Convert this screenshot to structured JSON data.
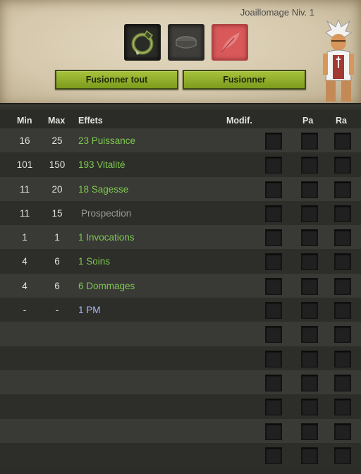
{
  "job": {
    "level_label": "Joaillomage Niv. 1"
  },
  "slots": [
    {
      "icon": "ring-item-icon",
      "state": "filled"
    },
    {
      "icon": "rune-slot-icon",
      "state": "empty"
    },
    {
      "icon": "feather-icon",
      "state": "empty"
    }
  ],
  "buttons": {
    "merge_all": "Fusionner tout",
    "merge": "Fusionner"
  },
  "columns": {
    "min": "Min",
    "max": "Max",
    "effects": "Effets",
    "modif": "Modif.",
    "pa": "Pa",
    "ra": "Ra"
  },
  "rows": [
    {
      "min": "16",
      "max": "25",
      "effect": "23 Puissance",
      "color": "green"
    },
    {
      "min": "101",
      "max": "150",
      "effect": "193 Vitalité",
      "color": "green"
    },
    {
      "min": "11",
      "max": "20",
      "effect": "18 Sagesse",
      "color": "green"
    },
    {
      "min": "11",
      "max": "15",
      "effect": "Prospection",
      "color": "grey"
    },
    {
      "min": "1",
      "max": "1",
      "effect": "1 Invocations",
      "color": "green"
    },
    {
      "min": "4",
      "max": "6",
      "effect": "1 Soins",
      "color": "green"
    },
    {
      "min": "4",
      "max": "6",
      "effect": "6 Dommages",
      "color": "green"
    },
    {
      "min": "-",
      "max": "-",
      "effect": "1 PM",
      "color": "blue"
    },
    {
      "min": "",
      "max": "",
      "effect": "",
      "color": "green"
    },
    {
      "min": "",
      "max": "",
      "effect": "",
      "color": "green"
    },
    {
      "min": "",
      "max": "",
      "effect": "",
      "color": "green"
    },
    {
      "min": "",
      "max": "",
      "effect": "",
      "color": "green"
    },
    {
      "min": "",
      "max": "",
      "effect": "",
      "color": "green"
    },
    {
      "min": "",
      "max": "",
      "effect": "",
      "color": "green"
    }
  ],
  "colors": {
    "green": "#7ec84f",
    "grey": "#9a9a96",
    "blue": "#a7bdf0",
    "button": "#8fae2a"
  }
}
